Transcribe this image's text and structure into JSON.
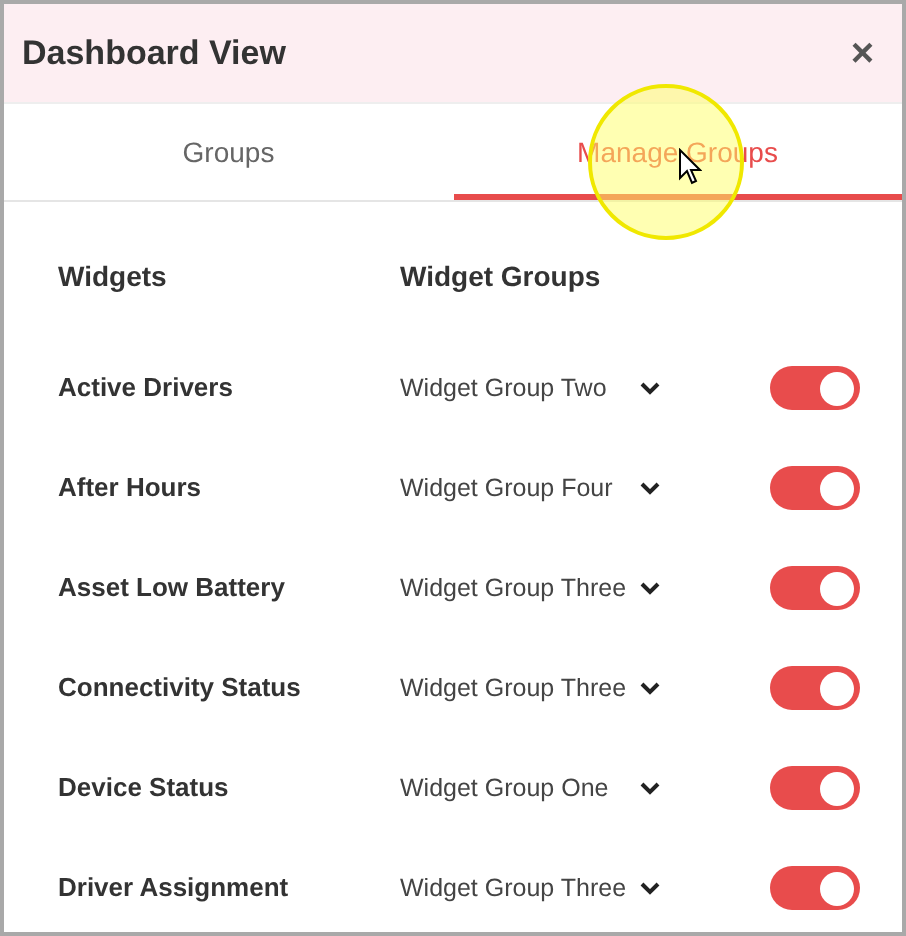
{
  "window": {
    "title": "Dashboard View",
    "close": "×"
  },
  "tabs": [
    {
      "label": "Groups",
      "selected": false
    },
    {
      "label": "Manage Groups",
      "selected": true
    }
  ],
  "table": {
    "columns": [
      "Widgets",
      "Widget Groups"
    ],
    "rows": [
      {
        "widget": "Active Drivers",
        "group": "Widget Group Two",
        "on": true
      },
      {
        "widget": "After Hours",
        "group": "Widget Group Four",
        "on": true
      },
      {
        "widget": "Asset Low Battery",
        "group": "Widget Group Three",
        "on": true
      },
      {
        "widget": "Connectivity Status",
        "group": "Widget Group Three",
        "on": true
      },
      {
        "widget": "Device Status",
        "group": "Widget Group One",
        "on": true
      },
      {
        "widget": "Driver Assignment",
        "group": "Widget Group Three",
        "on": true
      }
    ]
  }
}
